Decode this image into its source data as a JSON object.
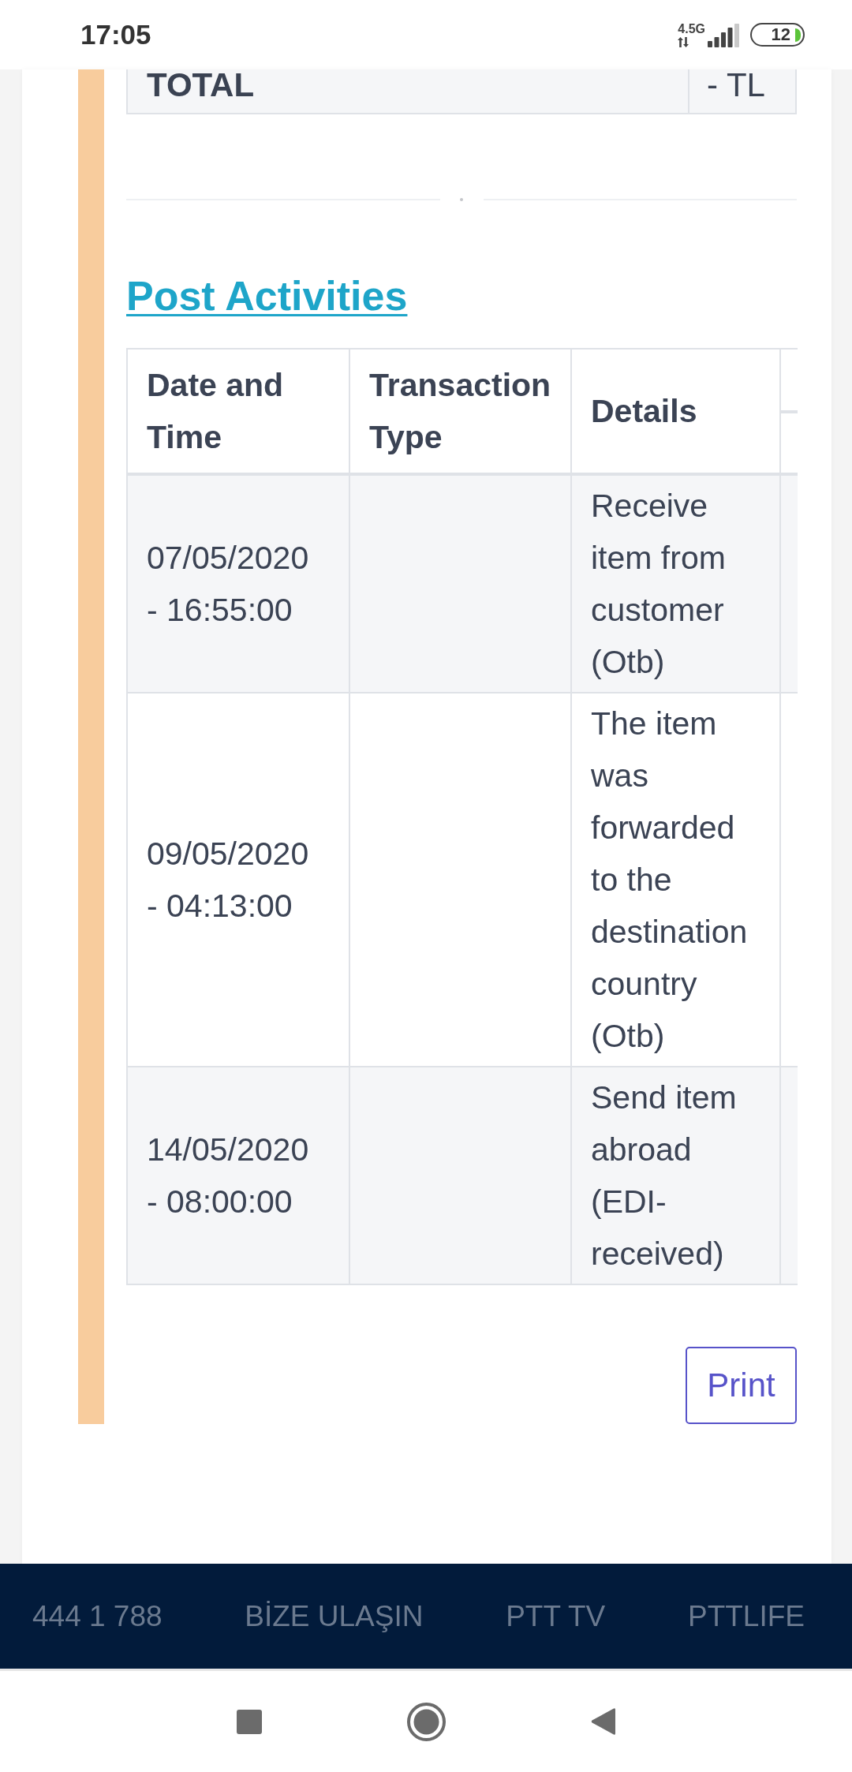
{
  "status_bar": {
    "time": "17:05",
    "network_type": "4.5G",
    "battery": "12"
  },
  "totals_table": {
    "rows": [
      {
        "label": "TOTAL",
        "value": "- TL"
      }
    ]
  },
  "post_activities": {
    "title": "Post Activities",
    "table": {
      "columns": [
        "Date and Time",
        "Transaction Type",
        "Details"
      ],
      "rows": [
        {
          "date_time": "07/05/2020 - 16:55:00",
          "details": "Receive item from customer (Otb)"
        },
        {
          "date_time": "09/05/2020 - 04:13:00",
          "details": "The item was forwarded to the destination country (Otb)"
        },
        {
          "date_time": "14/05/2020 - 08:00:00",
          "details": "Send item abroad (EDI-received)"
        }
      ]
    }
  },
  "print_button": {
    "label": "Print"
  },
  "footer": {
    "links": [
      "444 1 788",
      "BİZE ULAŞIN",
      "PTT TV",
      "PTTLIFE"
    ]
  }
}
